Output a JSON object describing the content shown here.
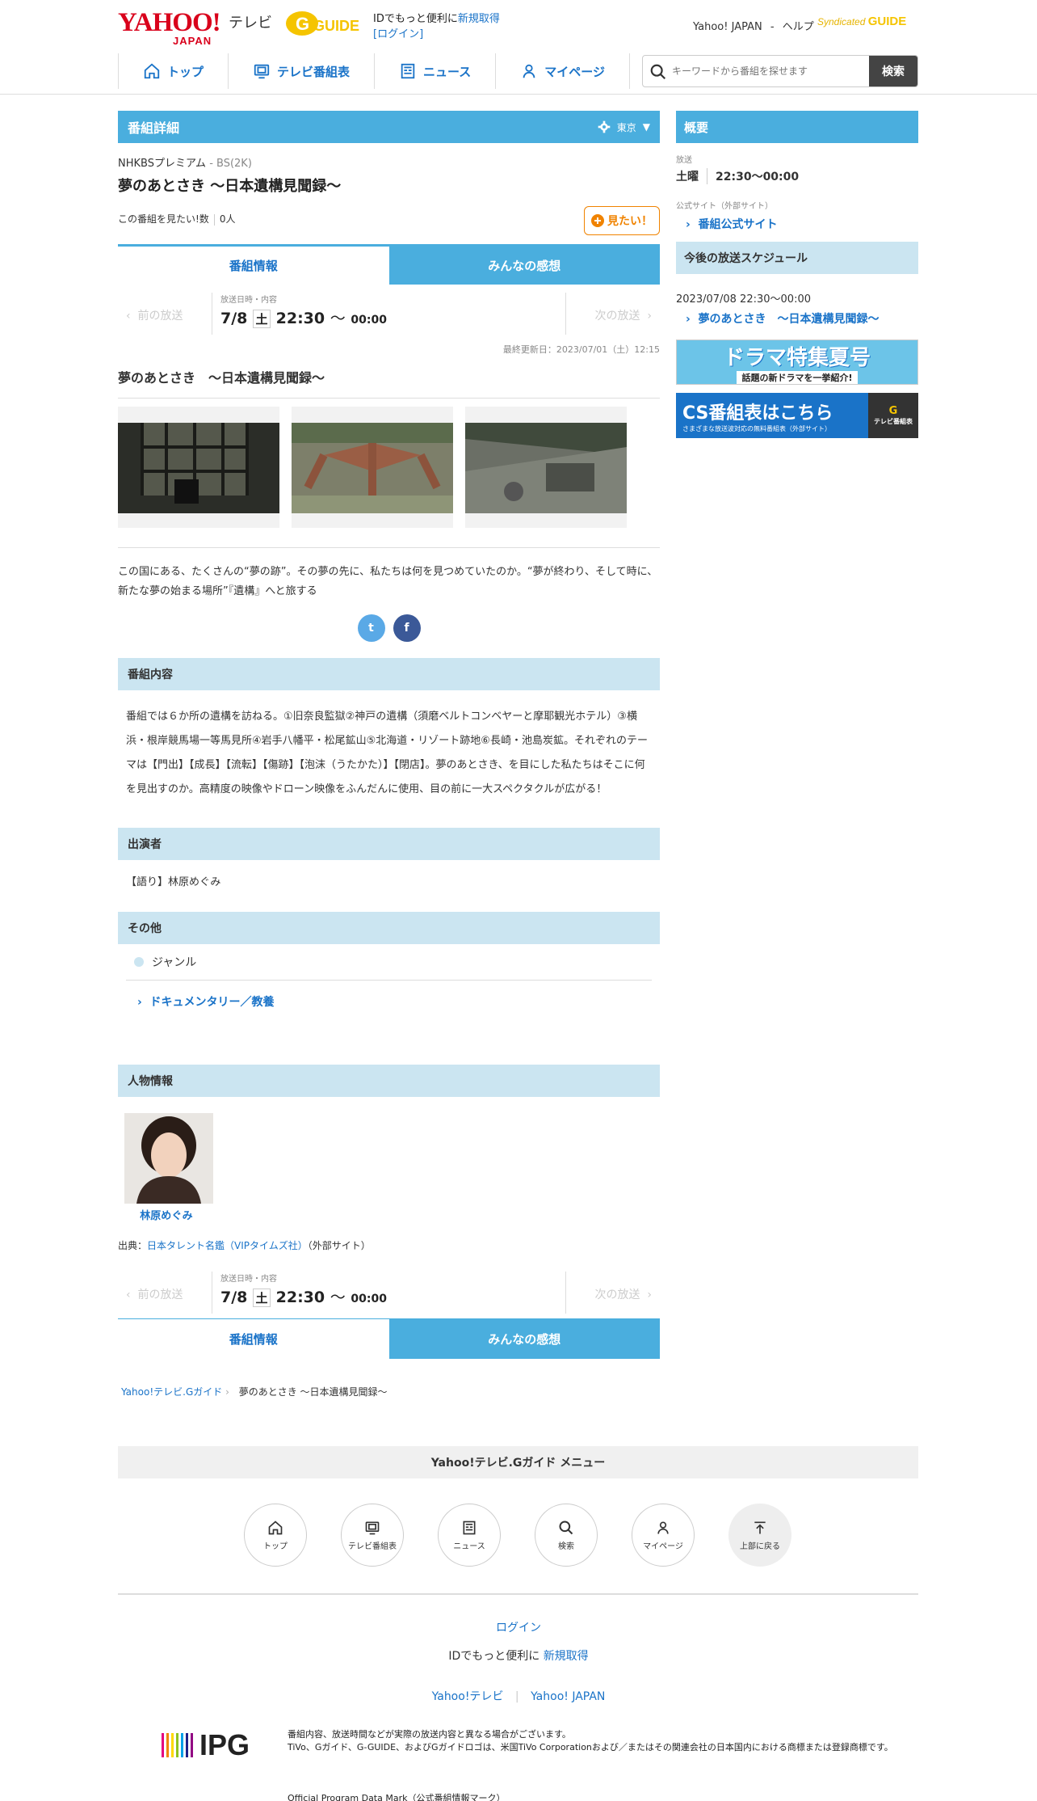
{
  "header": {
    "logo_yahoo": "YAHOO!",
    "logo_japan": "JAPAN",
    "logo_tv": "テレビ",
    "logo_guide": "GUIDE",
    "id_text": "IDでもっと便利に",
    "signup": "新規取得",
    "login": "[ログイン]",
    "yahoo_japan": "Yahoo! JAPAN",
    "dash": "-",
    "help": "ヘルプ",
    "syndicated": "Syndicated",
    "syndicated_guide": "GUIDE"
  },
  "nav": [
    {
      "label": "トップ",
      "icon": "home-icon"
    },
    {
      "label": "テレビ番組表",
      "icon": "tv-icon"
    },
    {
      "label": "ニュース",
      "icon": "news-icon"
    },
    {
      "label": "マイページ",
      "icon": "user-icon"
    }
  ],
  "search": {
    "placeholder": "キーワードから番組を探せます",
    "button": "検索"
  },
  "detail": {
    "heading": "番組詳細",
    "region": "東京",
    "channel": "NHKBSプレミアム",
    "channel_sub": "- BS(2K)",
    "title": "夢のあとさき 〜日本遺構見聞録〜",
    "want_label": "この番組を見たい!数",
    "want_count": "0人",
    "want_button": "見たい！"
  },
  "tabs": {
    "info": "番組情報",
    "impressions": "みんなの感想"
  },
  "broadcast": {
    "prev": "前の放送",
    "next": "次の放送",
    "label": "放送日時・内容",
    "date": "7/8",
    "day": "土",
    "start": "22:30",
    "tilde": "〜",
    "end": "00:00"
  },
  "updated": "最終更新日：2023/07/01（土）12:15",
  "subtitle": "夢のあとさき　〜日本遺構見聞録〜",
  "description": "この国にある、たくさんの“夢の跡”。その夢の先に、私たちは何を見つめていたのか。“夢が終わり、そして時に、新たな夢の始まる場所”『遺構』へと旅する",
  "sections": {
    "content": "番組内容",
    "content_text": "番組では６か所の遺構を訪ねる。①旧奈良監獄②神戸の遺構（須磨ベルトコンベヤーと摩耶観光ホテル）③横浜・根岸競馬場一等馬見所④岩手八幡平・松尾鉱山⑤北海道・リゾート跡地⑥長崎・池島炭鉱。それぞれのテーマは【門出】【成長】【流転】【傷跡】【泡沫（うたかた）】【閉店】。夢のあとさき、を目にした私たちはそこに何を見出すのか。高精度の映像やドローン映像をふんだんに使用、目の前に一大スペクタクルが広がる！",
    "cast": "出演者",
    "cast_text": "【語り】林原めぐみ",
    "other": "その他",
    "genre": "ジャンル",
    "genre_link": "ドキュメンタリー／教養",
    "person": "人物情報",
    "person_name": "林原めぐみ",
    "source_prefix": "出典：",
    "source_link": "日本タレント名鑑（VIPタイムズ社）",
    "source_suffix": "（外部サイト）"
  },
  "breadcrumb": {
    "home": "Yahoo!テレビ.Gガイド",
    "current": "夢のあとさき 〜日本遺構見聞録〜"
  },
  "side": {
    "summary": "概要",
    "broadcast_label": "放送",
    "day": "土曜",
    "time": "22:30〜00:00",
    "official_label": "公式サイト（外部サイト）",
    "official_link": "番組公式サイト",
    "schedule": "今後の放送スケジュール",
    "schedule_date": "2023/07/08 22:30〜00:00",
    "schedule_link": "夢のあとさき　〜日本遺構見聞録〜",
    "banner1": "ドラマ特集夏号",
    "banner1_sub": "話題の新ドラマを一挙紹介!",
    "banner2": "CS番組表はこちら",
    "banner2_sub": "さまざまな放送波対応の無料番組表（外部サイト）",
    "banner2_side": "テレビ番組表"
  },
  "footer": {
    "menu": "Yahoo!テレビ.Gガイド メニュー",
    "circles": [
      {
        "label": "トップ",
        "icon": "home-icon"
      },
      {
        "label": "テレビ番組表",
        "icon": "tv-icon"
      },
      {
        "label": "ニュース",
        "icon": "news-icon"
      },
      {
        "label": "検索",
        "icon": "search-icon"
      },
      {
        "label": "マイページ",
        "icon": "user-icon"
      },
      {
        "label": "上部に戻る",
        "icon": "arrow-up-icon"
      }
    ],
    "login": "ログイン",
    "id_text": "IDでもっと便利に",
    "signup": "新規取得",
    "link1": "Yahoo!テレビ",
    "link2": "Yahoo! JAPAN",
    "ipg": "IPG",
    "disclaimer1": "番組内容、放送時間などが実際の放送内容と異なる場合がございます。",
    "disclaimer2": "TiVo、Gガイド、G-GUIDE、およびGガイドロゴは、米国TiVo Corporationおよび／またはその関連会社の日本国内における商標または登録商標です。",
    "opd": "Official Program Data Mark（公式番組情報マーク）"
  },
  "colors": {
    "accent": "#4aaede",
    "light": "#cbe5f1",
    "link": "#1a73c8",
    "want": "#f08300"
  }
}
